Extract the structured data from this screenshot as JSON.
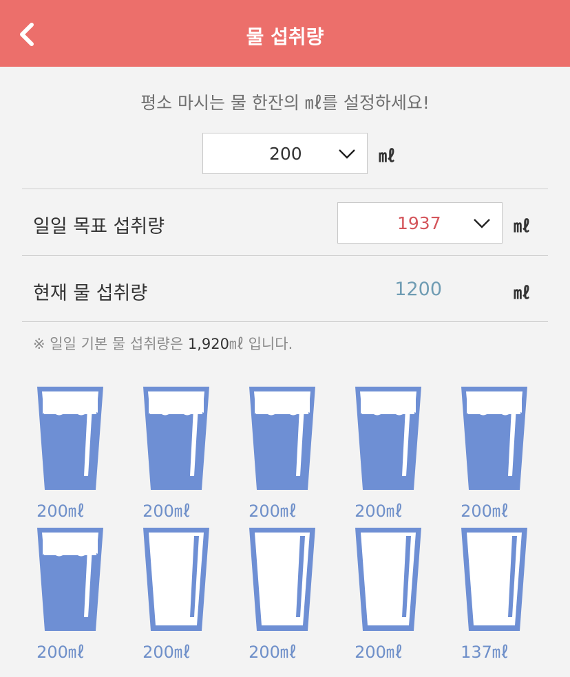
{
  "header": {
    "title": "물 섭취량",
    "back_icon": "chevron-left-icon"
  },
  "instruction": "평소 마시는 물 한잔의 ㎖를 설정하세요!",
  "cup_size": {
    "value": "200",
    "unit": "㎖"
  },
  "daily_goal": {
    "label": "일일 목표 섭취량",
    "value": "1937",
    "unit": "㎖",
    "value_color": "#d4555b"
  },
  "current_intake": {
    "label": "현재 물 섭취량",
    "value": "1200",
    "unit": "㎖",
    "value_color": "#6f9cb3"
  },
  "note": {
    "prefix": "※ 일일 기본 물 섭취량은 ",
    "amount": "1,920",
    "suffix": "㎖ 입니다."
  },
  "glasses": [
    {
      "label": "200㎖",
      "fill": 1
    },
    {
      "label": "200㎖",
      "fill": 1
    },
    {
      "label": "200㎖",
      "fill": 1
    },
    {
      "label": "200㎖",
      "fill": 1
    },
    {
      "label": "200㎖",
      "fill": 1
    },
    {
      "label": "200㎖",
      "fill": 1
    },
    {
      "label": "200㎖",
      "fill": 0
    },
    {
      "label": "200㎖",
      "fill": 0
    },
    {
      "label": "200㎖",
      "fill": 0
    },
    {
      "label": "137㎖",
      "fill": 0
    }
  ],
  "colors": {
    "header": "#ec6f6b",
    "glass": "#6e8fd4",
    "glass_label": "#6e8fc9"
  }
}
